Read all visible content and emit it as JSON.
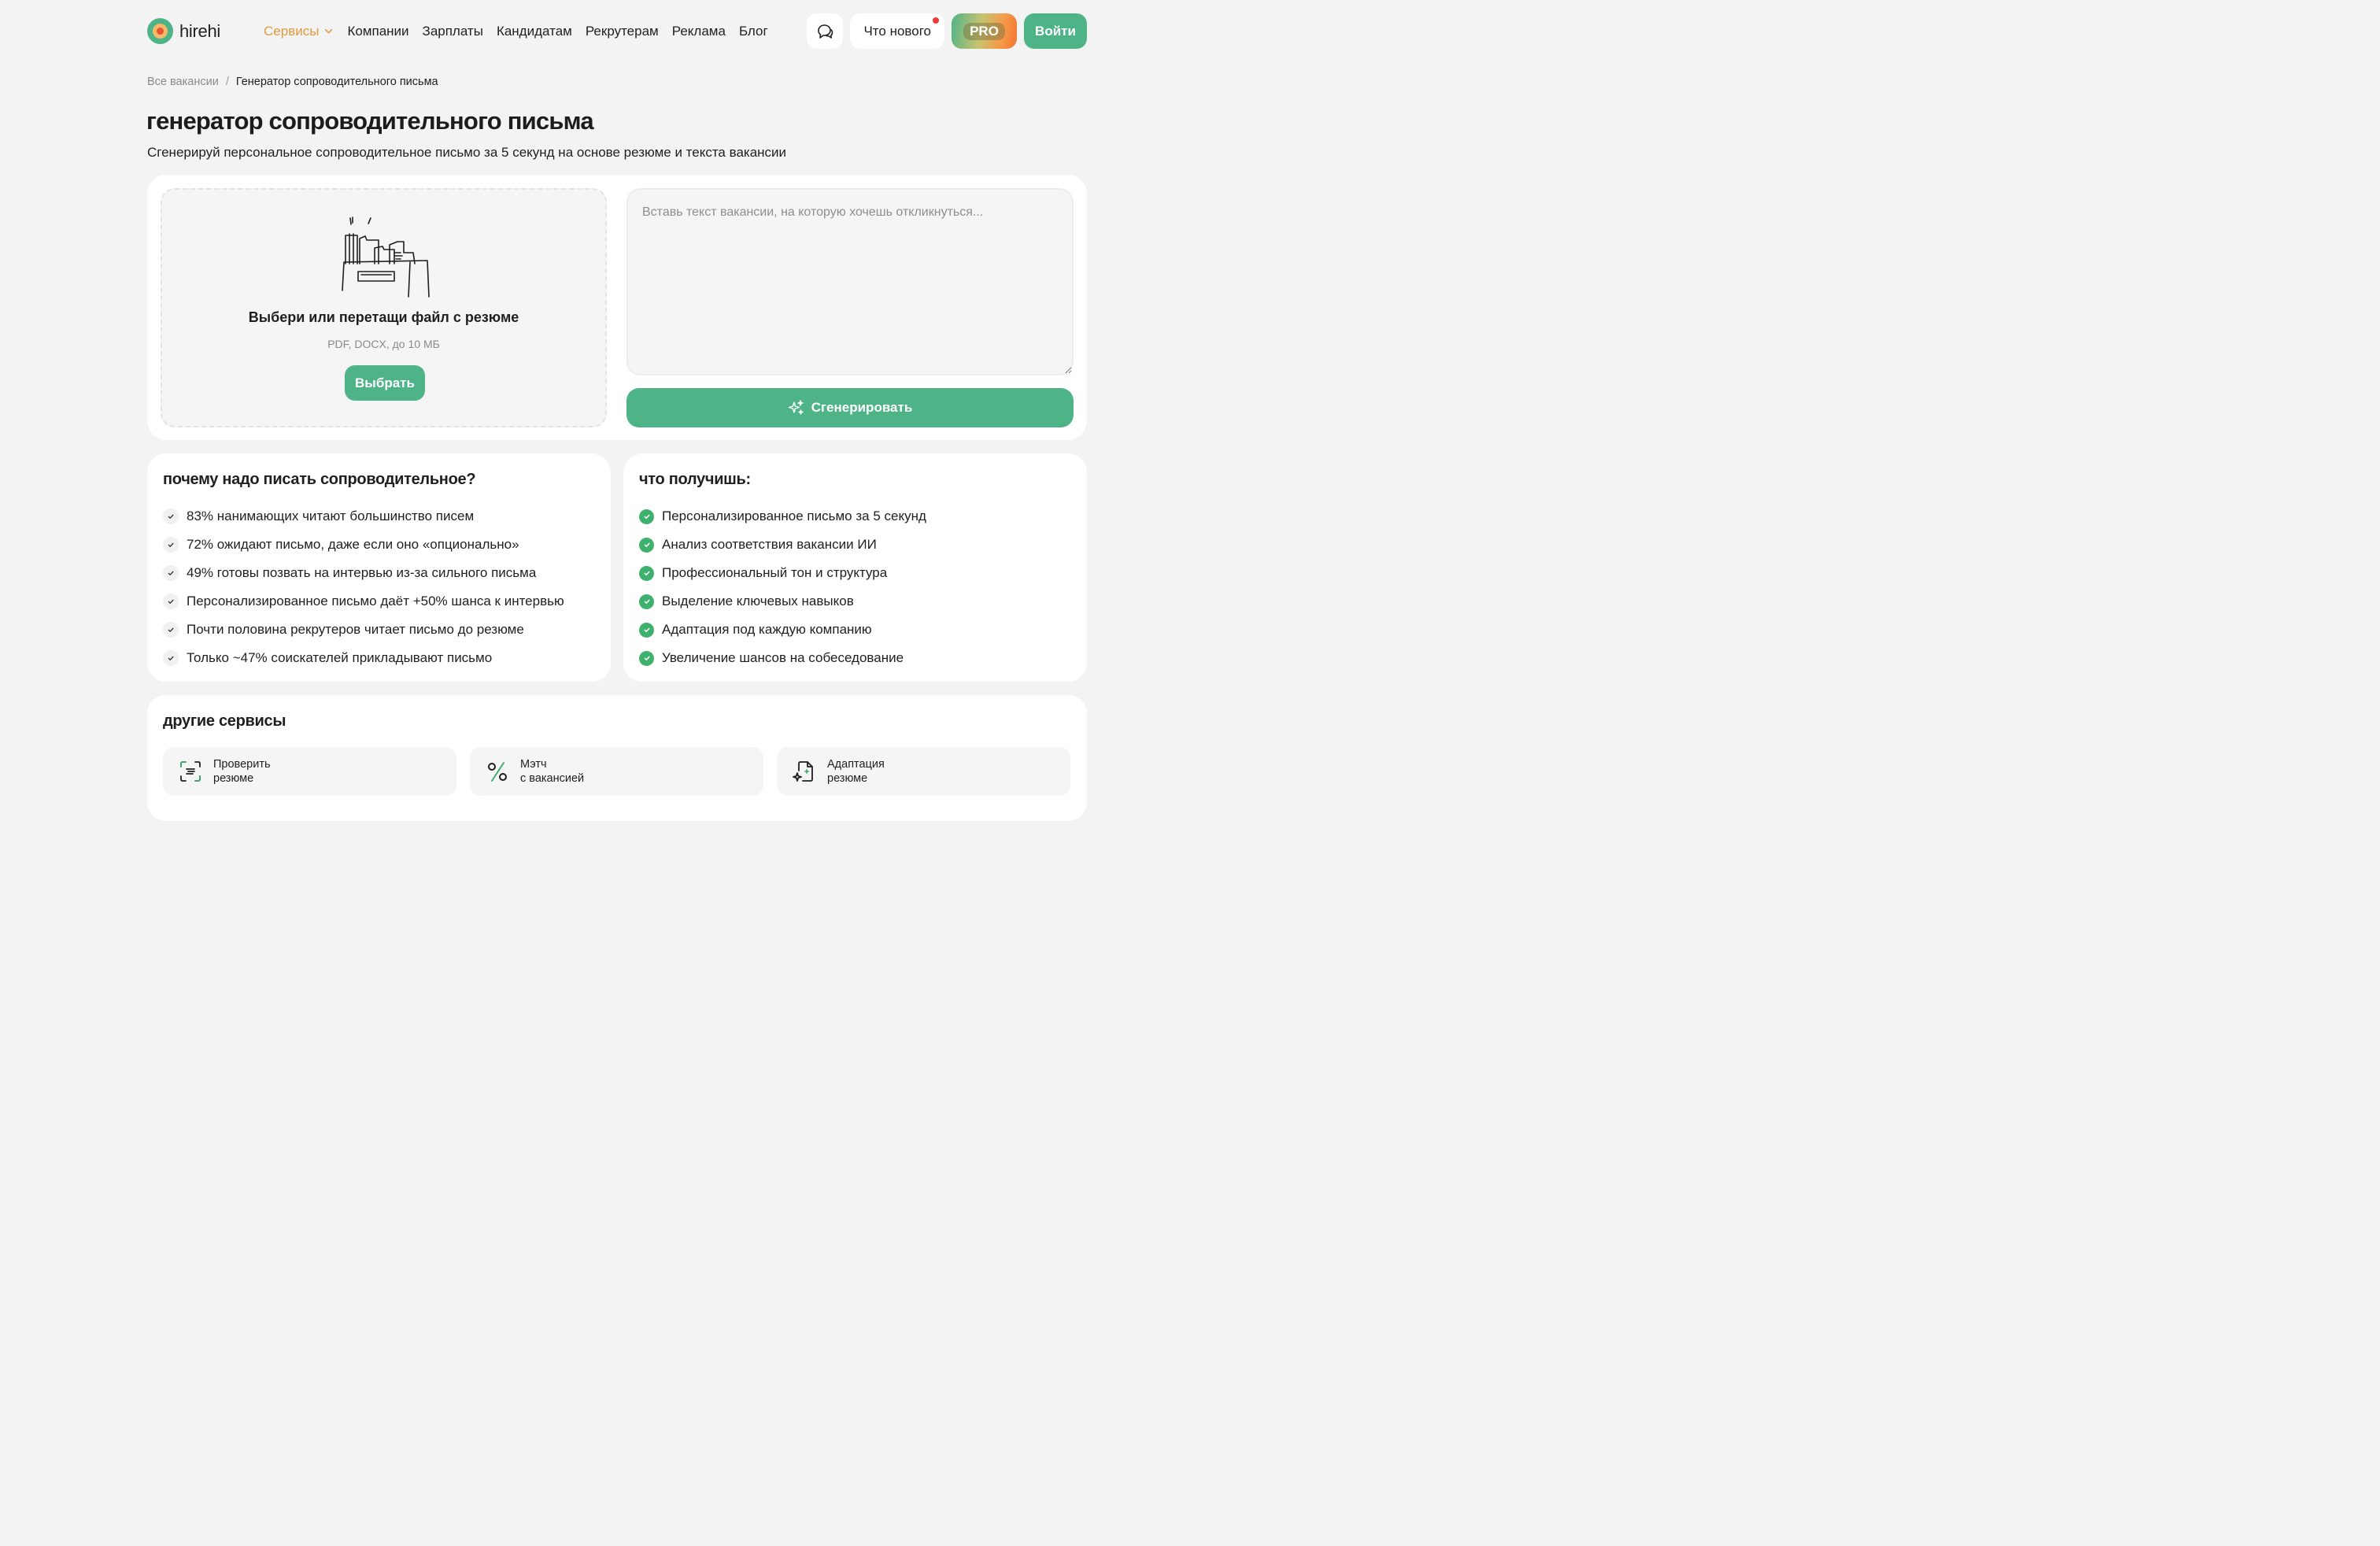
{
  "header": {
    "logo_text": "hirehi",
    "nav": [
      {
        "label": "Сервисы",
        "active": true
      },
      {
        "label": "Компании"
      },
      {
        "label": "Зарплаты"
      },
      {
        "label": "Кандидатам"
      },
      {
        "label": "Рекрутерам"
      },
      {
        "label": "Реклама"
      },
      {
        "label": "Блог"
      }
    ],
    "news_label": "Что нового",
    "pro_label": "PRO",
    "login_label": "Войти"
  },
  "breadcrumb": {
    "root": "Все вакансии",
    "separator": "/",
    "current": "Генератор сопроводительного письма"
  },
  "page": {
    "title": "генератор сопроводительного письма",
    "subtitle": "Сгенерируй персональное сопроводительное письмо за 5 секунд на основе резюме и текста вакансии"
  },
  "upload": {
    "title": "Выбери или перетащи файл с резюме",
    "hint": "PDF, DOCX, до 10 МБ",
    "button": "Выбрать"
  },
  "vacancy": {
    "placeholder": "Вставь текст вакансии, на которую хочешь откликнуться...",
    "value": ""
  },
  "generate": {
    "label": "Сгенерировать"
  },
  "why": {
    "title": "почему надо писать сопроводительное?",
    "items": [
      "83% нанимающих читают большинство писем",
      "72% ожидают письмо, даже если оно «опционально»",
      "49% готовы позвать на интервью из-за сильного письма",
      "Персонализированное письмо даёт +50% шанса к интервью",
      "Почти половина рекрутеров читает письмо до резюме",
      "Только ~47% соискателей прикладывают письмо"
    ]
  },
  "benefits": {
    "title": "что получишь:",
    "items": [
      "Персонализированное письмо за 5 секунд",
      "Анализ соответствия вакансии ИИ",
      "Профессиональный тон и структура",
      "Выделение ключевых навыков",
      "Адаптация под каждую компанию",
      "Увеличение шансов на собеседование"
    ]
  },
  "services": {
    "title": "другие сервисы",
    "items": [
      {
        "line1": "Проверить",
        "line2": "резюме",
        "icon": "document-scan-icon"
      },
      {
        "line1": "Мэтч",
        "line2": "с вакансией",
        "icon": "percent-icon"
      },
      {
        "line1": "Адаптация",
        "line2": "резюме",
        "icon": "document-sparkle-icon"
      }
    ]
  },
  "colors": {
    "accent": "#4eb487",
    "nav_active": "#e49a3b",
    "notify_dot": "#ef3b3b",
    "check_green": "#3fb16e"
  }
}
